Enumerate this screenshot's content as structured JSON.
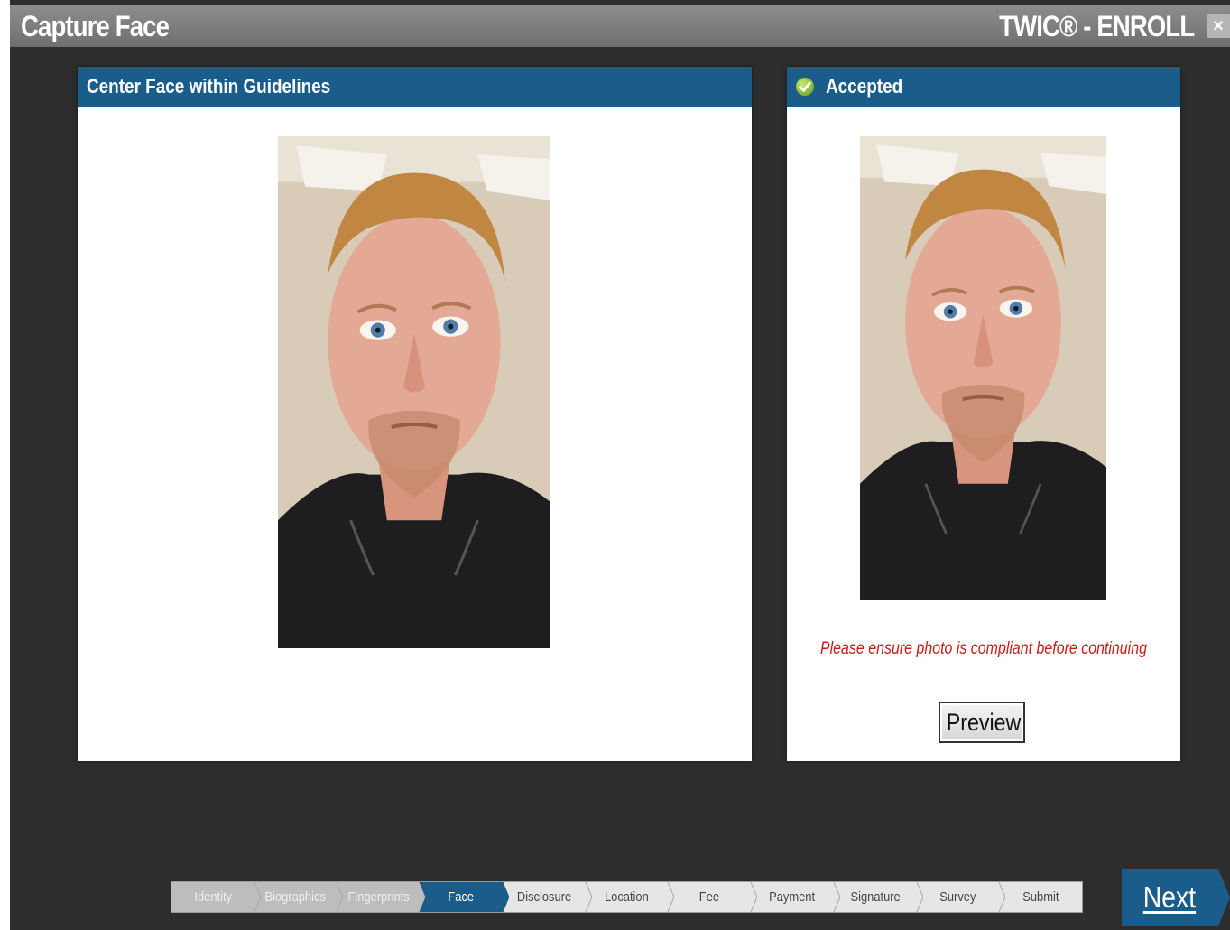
{
  "titlebar": {
    "title": "Capture Face",
    "brand": "TWIC® - ENROLL",
    "close_label": "×"
  },
  "capture_panel": {
    "header": "Center Face within Guidelines",
    "photo_icon": "live-camera-face-photo"
  },
  "accepted_panel": {
    "header": "Accepted",
    "status_icon": "check-circle-icon",
    "status_color": "#6aa81c",
    "photo_icon": "accepted-face-photo",
    "warning": "Please ensure photo is compliant before continuing",
    "warning_color": "#cc1a1a",
    "preview_label": "Preview"
  },
  "steps": [
    {
      "label": "Identity",
      "state": "done"
    },
    {
      "label": "Biographics",
      "state": "done"
    },
    {
      "label": "Fingerprints",
      "state": "done"
    },
    {
      "label": "Face",
      "state": "active"
    },
    {
      "label": "Disclosure",
      "state": "pending"
    },
    {
      "label": "Location",
      "state": "pending"
    },
    {
      "label": "Fee",
      "state": "pending"
    },
    {
      "label": "Payment",
      "state": "pending"
    },
    {
      "label": "Signature",
      "state": "pending"
    },
    {
      "label": "Survey",
      "state": "pending"
    },
    {
      "label": "Submit",
      "state": "pending"
    }
  ],
  "next_label": "Next",
  "colors": {
    "accent": "#1b5d8a",
    "background": "#2d2d2d",
    "titlebar": "#7e7e7e"
  }
}
